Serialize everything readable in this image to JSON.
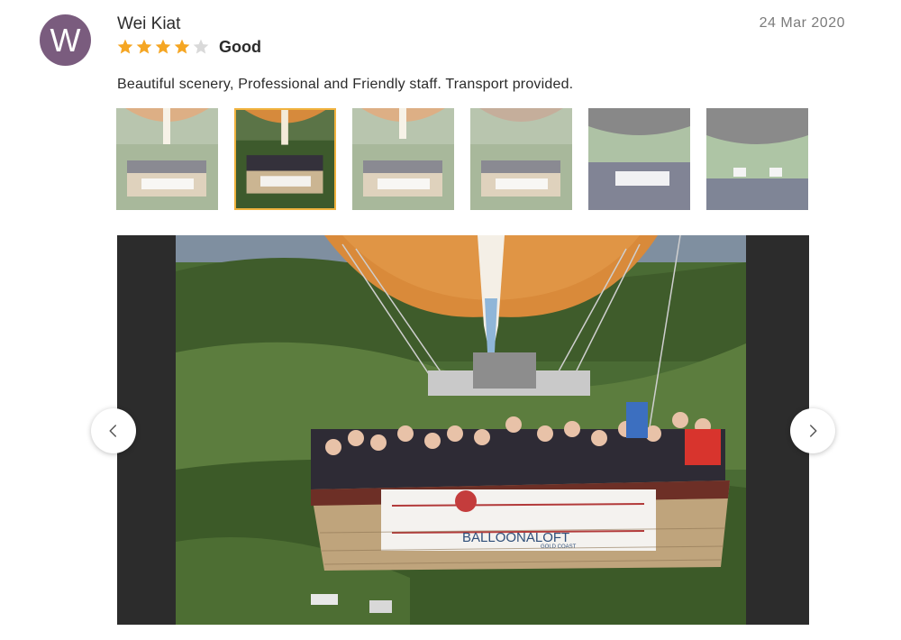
{
  "review": {
    "avatar_initial": "W",
    "reviewer_name": "Wei Kiat",
    "date": "24 Mar 2020",
    "rating": 4,
    "rating_max": 5,
    "rating_label": "Good",
    "text": "Beautiful scenery, Professional and Friendly staff. Transport provided."
  },
  "gallery": {
    "thumbnail_count": 6,
    "active_index": 1,
    "banner_text": "BALLOONALOFT",
    "banner_subtext": "GOLD COAST"
  },
  "icons": {
    "prev": "chevron-left-icon",
    "next": "chevron-right-icon",
    "star": "star-icon"
  },
  "colors": {
    "avatar": "#7a5c7e",
    "star_filled": "#f5a623",
    "star_empty": "#d9d9d9",
    "active_thumb_border": "#f0b23e",
    "viewer_background": "#2c2c2c"
  }
}
